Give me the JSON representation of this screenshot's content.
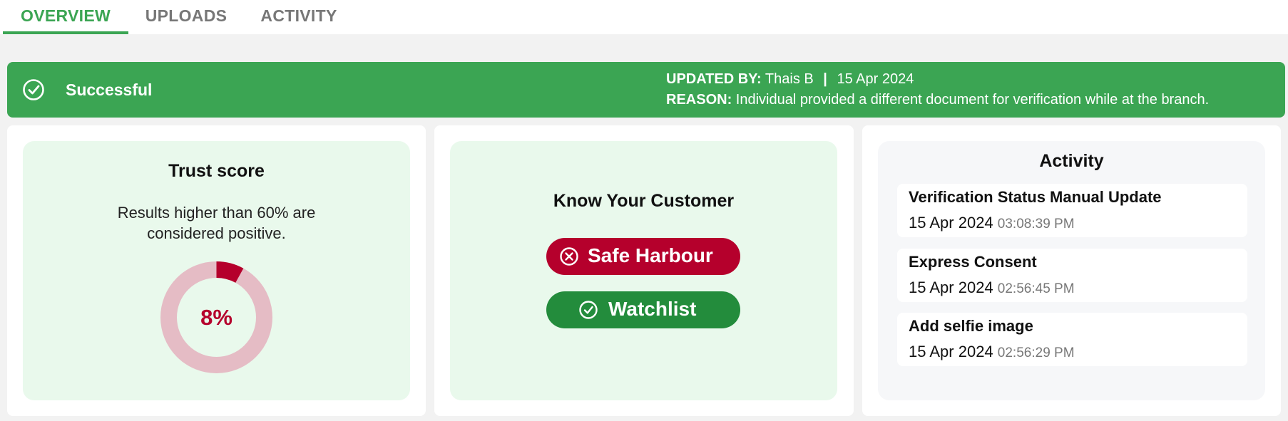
{
  "tabs": [
    {
      "label": "OVERVIEW",
      "active": true
    },
    {
      "label": "UPLOADS",
      "active": false
    },
    {
      "label": "ACTIVITY",
      "active": false
    }
  ],
  "banner": {
    "status": "Successful",
    "status_icon": "check-circle-icon",
    "updated_by_label": "UPDATED BY:",
    "updated_by": "Thais B",
    "separator": "|",
    "date": "15 Apr 2024",
    "reason_label": "REASON:",
    "reason": "Individual provided a different document for verification while at the branch.",
    "color": "#3ba553"
  },
  "trust_score": {
    "title": "Trust score",
    "description": "Results higher than 60% are considered positive.",
    "value_label": "8%",
    "value_fraction": 0.08,
    "color_fill": "#b5002c",
    "color_track": "#e5bcc5"
  },
  "kyc": {
    "title": "Know Your Customer",
    "items": [
      {
        "label": "Safe Harbour",
        "status": "failed",
        "icon": "x-circle-icon",
        "color": "#b5002c"
      },
      {
        "label": "Watchlist",
        "status": "passed",
        "icon": "check-circle-icon",
        "color": "#238c3c"
      }
    ]
  },
  "activity": {
    "title": "Activity",
    "items": [
      {
        "title": "Verification Status Manual Update",
        "date": "15 Apr 2024",
        "time": "03:08:39 PM"
      },
      {
        "title": "Express Consent",
        "date": "15 Apr 2024",
        "time": "02:56:45 PM"
      },
      {
        "title": "Add selfie image",
        "date": "15 Apr 2024",
        "time": "02:56:29 PM"
      }
    ]
  }
}
